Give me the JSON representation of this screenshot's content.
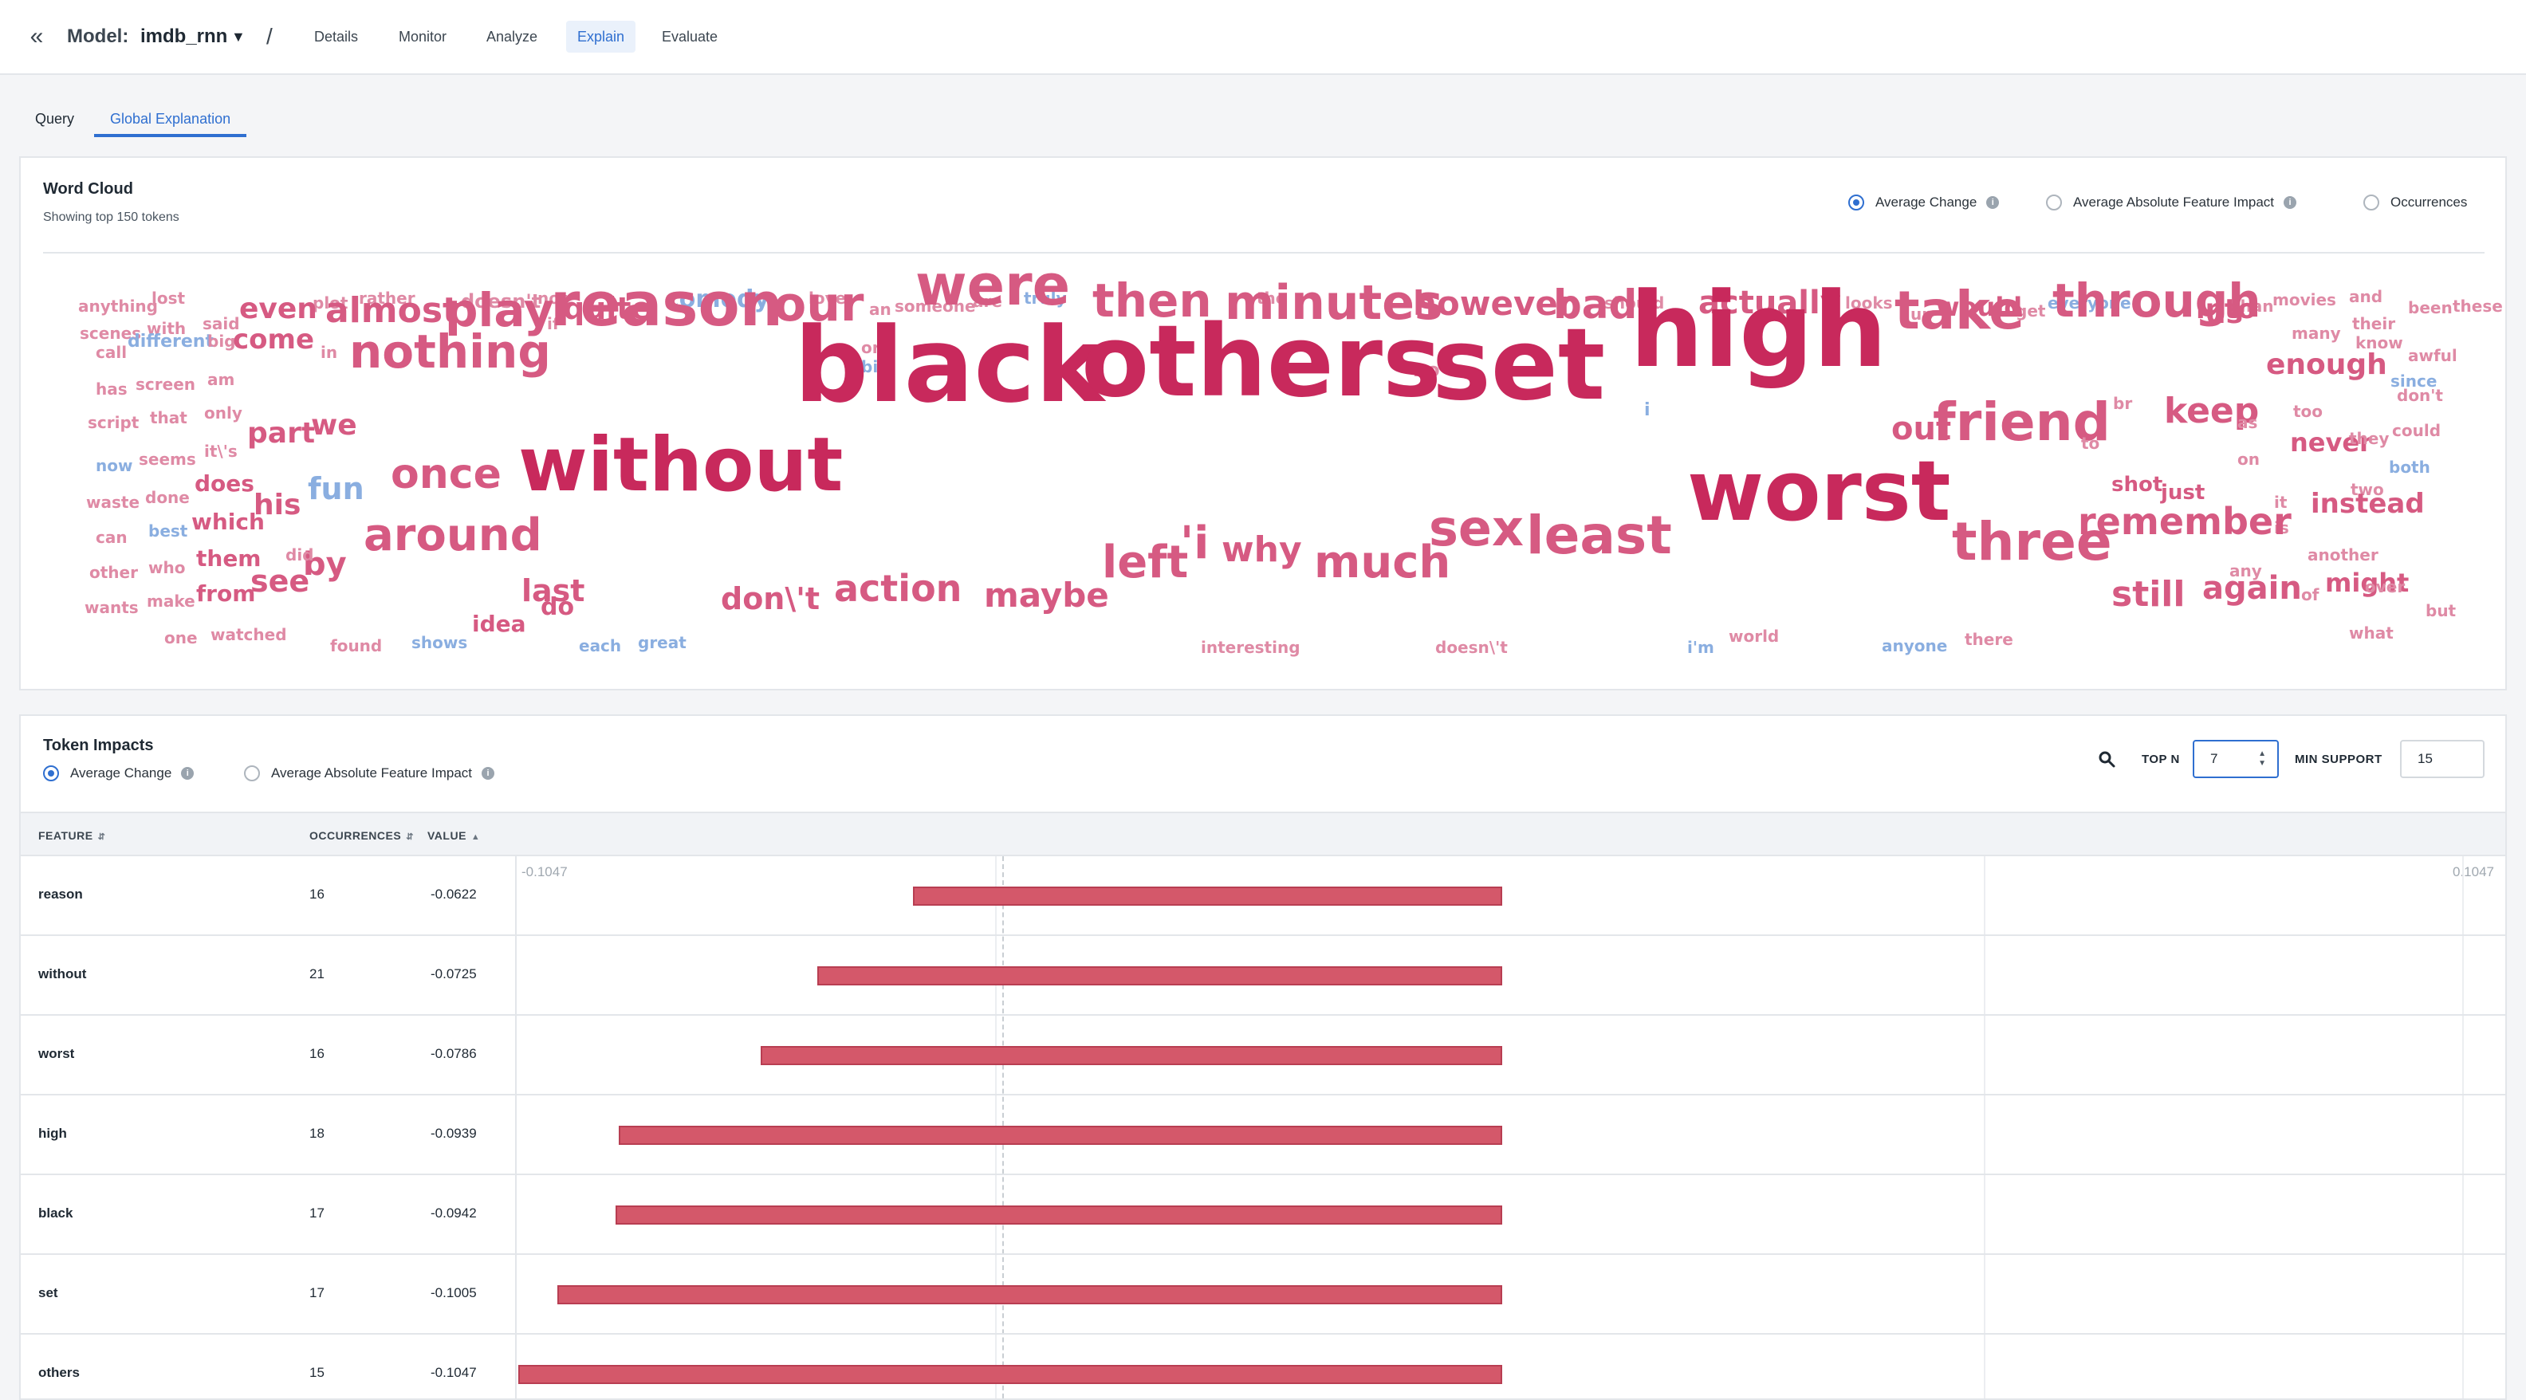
{
  "header": {
    "back_icon": "double-chevron-left-icon",
    "model_label": "Model:",
    "model_name": "imdb_rnn",
    "separator": "/",
    "nav": [
      "Details",
      "Monitor",
      "Analyze",
      "Explain",
      "Evaluate"
    ],
    "active_nav": "Explain"
  },
  "subtabs": {
    "items": [
      "Query",
      "Global Explanation"
    ],
    "active": "Global Explanation"
  },
  "word_cloud": {
    "title": "Word Cloud",
    "subtitle": "Showing top 150 tokens",
    "options": [
      "Average Change",
      "Average Absolute Feature Impact",
      "Occurrences"
    ],
    "selected": "Average Change",
    "colors": {
      "strong": "#c8295c",
      "mid": "#d65a82",
      "light": "#df8aa5",
      "blue": "#8aaee0"
    },
    "words": [
      {
        "t": "anything",
        "c": "light",
        "s": 20
      },
      {
        "t": "lost",
        "c": "light",
        "s": 20
      },
      {
        "t": "plot",
        "c": "light",
        "s": 20
      },
      {
        "t": "rather",
        "c": "light",
        "s": 20
      },
      {
        "t": "doesn't",
        "c": "light",
        "s": 24
      },
      {
        "t": "not",
        "c": "light",
        "s": 20
      },
      {
        "t": "comedy",
        "c": "blue",
        "s": 30
      },
      {
        "t": "love",
        "c": "light",
        "s": 20
      },
      {
        "t": "an",
        "c": "light",
        "s": 20
      },
      {
        "t": "someone",
        "c": "light",
        "s": 20
      },
      {
        "t": "are",
        "c": "light",
        "s": 20
      },
      {
        "t": "truly",
        "c": "blue",
        "s": 20
      },
      {
        "t": "the",
        "c": "light",
        "s": 20
      },
      {
        "t": "should",
        "c": "light",
        "s": 20
      },
      {
        "t": "looks",
        "c": "light",
        "s": 20
      },
      {
        "t": "than",
        "c": "light",
        "s": 20
      },
      {
        "t": "movies",
        "c": "light",
        "s": 20
      },
      {
        "t": "and",
        "c": "light",
        "s": 20
      },
      {
        "t": "been",
        "c": "light",
        "s": 20
      },
      {
        "t": "these",
        "c": "light",
        "s": 20
      },
      {
        "t": "scenes",
        "c": "light",
        "s": 20
      },
      {
        "t": "with",
        "c": "light",
        "s": 20
      },
      {
        "t": "said",
        "c": "light",
        "s": 20
      },
      {
        "t": "even",
        "c": "mid",
        "s": 36
      },
      {
        "t": "almost",
        "c": "mid",
        "s": 44
      },
      {
        "t": "if",
        "c": "light",
        "s": 20
      },
      {
        "t": "quite",
        "c": "mid",
        "s": 38
      },
      {
        "t": "actually",
        "c": "mid",
        "s": 40
      },
      {
        "t": "would",
        "c": "mid",
        "s": 32
      },
      {
        "t": "get",
        "c": "light",
        "s": 20
      },
      {
        "t": "everyone",
        "c": "blue",
        "s": 20
      },
      {
        "t": "up",
        "c": "light",
        "s": 20
      },
      {
        "t": "their",
        "c": "light",
        "s": 20
      },
      {
        "t": "into",
        "c": "mid",
        "s": 34
      },
      {
        "t": "call",
        "c": "light",
        "s": 20
      },
      {
        "t": "different",
        "c": "blue",
        "s": 22
      },
      {
        "t": "big",
        "c": "light",
        "s": 20
      },
      {
        "t": "come",
        "c": "mid",
        "s": 34
      },
      {
        "t": "in",
        "c": "light",
        "s": 20
      },
      {
        "t": "play",
        "c": "mid",
        "s": 58
      },
      {
        "t": "reason",
        "c": "mid",
        "s": 76
      },
      {
        "t": "our",
        "c": "mid",
        "s": 60
      },
      {
        "t": "were",
        "c": "mid",
        "s": 70
      },
      {
        "t": "then",
        "c": "mid",
        "s": 58
      },
      {
        "t": "minutes",
        "c": "mid",
        "s": 60
      },
      {
        "t": "however",
        "c": "mid",
        "s": 42
      },
      {
        "t": "no",
        "c": "light",
        "s": 24
      },
      {
        "t": "bad",
        "c": "mid",
        "s": 50
      },
      {
        "t": "or",
        "c": "light",
        "s": 20
      },
      {
        "t": "bit",
        "c": "blue",
        "s": 20
      },
      {
        "t": "take",
        "c": "mid",
        "s": 66
      },
      {
        "t": "through",
        "c": "mid",
        "s": 58
      },
      {
        "t": "us",
        "c": "mid",
        "s": 36
      },
      {
        "t": "many",
        "c": "light",
        "s": 20
      },
      {
        "t": "know",
        "c": "light",
        "s": 20
      },
      {
        "t": "awful",
        "c": "light",
        "s": 20
      },
      {
        "t": "since",
        "c": "blue",
        "s": 20
      },
      {
        "t": "has",
        "c": "light",
        "s": 20
      },
      {
        "t": "screen",
        "c": "light",
        "s": 20
      },
      {
        "t": "am",
        "c": "light",
        "s": 20
      },
      {
        "t": "script",
        "c": "light",
        "s": 20
      },
      {
        "t": "that",
        "c": "light",
        "s": 20
      },
      {
        "t": "only",
        "c": "light",
        "s": 20
      },
      {
        "t": "nothing",
        "c": "mid",
        "s": 58
      },
      {
        "t": "enough",
        "c": "mid",
        "s": 36
      },
      {
        "t": "don't",
        "c": "light",
        "s": 20
      },
      {
        "t": "black",
        "c": "strong",
        "s": 130
      },
      {
        "t": "others",
        "c": "strong",
        "s": 124
      },
      {
        "t": "set",
        "c": "strong",
        "s": 124
      },
      {
        "t": "high",
        "c": "strong",
        "s": 130
      },
      {
        "t": "i",
        "c": "blue",
        "s": 22
      },
      {
        "t": "br",
        "c": "light",
        "s": 20
      },
      {
        "t": "too",
        "c": "light",
        "s": 20
      },
      {
        "t": "could",
        "c": "light",
        "s": 20
      },
      {
        "t": "part",
        "c": "mid",
        "s": 36
      },
      {
        "t": "we",
        "c": "mid",
        "s": 36
      },
      {
        "t": "it\\'s",
        "c": "light",
        "s": 20
      },
      {
        "t": "now",
        "c": "blue",
        "s": 20
      },
      {
        "t": "seems",
        "c": "light",
        "s": 20
      },
      {
        "t": "out",
        "c": "mid",
        "s": 40
      },
      {
        "t": "friend",
        "c": "mid",
        "s": 66
      },
      {
        "t": "keep",
        "c": "mid",
        "s": 44
      },
      {
        "t": "as",
        "c": "light",
        "s": 20
      },
      {
        "t": "to",
        "c": "light",
        "s": 20
      },
      {
        "t": "never",
        "c": "mid",
        "s": 32
      },
      {
        "t": "they",
        "c": "light",
        "s": 20
      },
      {
        "t": "both",
        "c": "blue",
        "s": 20
      },
      {
        "t": "on",
        "c": "light",
        "s": 20
      },
      {
        "t": "waste",
        "c": "light",
        "s": 20
      },
      {
        "t": "done",
        "c": "light",
        "s": 20
      },
      {
        "t": "does",
        "c": "mid",
        "s": 28
      },
      {
        "t": "his",
        "c": "mid",
        "s": 36
      },
      {
        "t": "fun",
        "c": "blue",
        "s": 38
      },
      {
        "t": "once",
        "c": "mid",
        "s": 52
      },
      {
        "t": "without",
        "c": "strong",
        "s": 94
      },
      {
        "t": "shot",
        "c": "mid",
        "s": 26
      },
      {
        "t": "just",
        "c": "mid",
        "s": 26
      },
      {
        "t": "it",
        "c": "light",
        "s": 20
      },
      {
        "t": "two",
        "c": "light",
        "s": 20
      },
      {
        "t": "can",
        "c": "light",
        "s": 20
      },
      {
        "t": "best",
        "c": "blue",
        "s": 20
      },
      {
        "t": "which",
        "c": "mid",
        "s": 28
      },
      {
        "t": "instead",
        "c": "mid",
        "s": 34
      },
      {
        "t": "is",
        "c": "light",
        "s": 20
      },
      {
        "t": "around",
        "c": "mid",
        "s": 56
      },
      {
        "t": "worst",
        "c": "strong",
        "s": 104
      },
      {
        "t": "remember",
        "c": "mid",
        "s": 46
      },
      {
        "t": "other",
        "c": "light",
        "s": 20
      },
      {
        "t": "who",
        "c": "light",
        "s": 20
      },
      {
        "t": "them",
        "c": "mid",
        "s": 28
      },
      {
        "t": "by",
        "c": "mid",
        "s": 40
      },
      {
        "t": "did",
        "c": "light",
        "s": 20
      },
      {
        "t": "left",
        "c": "mid",
        "s": 56
      },
      {
        "t": "'i",
        "c": "mid",
        "s": 56
      },
      {
        "t": "why",
        "c": "mid",
        "s": 44
      },
      {
        "t": "much",
        "c": "mid",
        "s": 56
      },
      {
        "t": "sex",
        "c": "mid",
        "s": 62
      },
      {
        "t": "least",
        "c": "mid",
        "s": 66
      },
      {
        "t": "three",
        "c": "mid",
        "s": 66
      },
      {
        "t": "any",
        "c": "light",
        "s": 20
      },
      {
        "t": "another",
        "c": "light",
        "s": 20
      },
      {
        "t": "wants",
        "c": "light",
        "s": 20
      },
      {
        "t": "make",
        "c": "light",
        "s": 20
      },
      {
        "t": "from",
        "c": "mid",
        "s": 28
      },
      {
        "t": "see",
        "c": "mid",
        "s": 38
      },
      {
        "t": "last",
        "c": "mid",
        "s": 38
      },
      {
        "t": "do",
        "c": "mid",
        "s": 30
      },
      {
        "t": "don\\'t",
        "c": "mid",
        "s": 38
      },
      {
        "t": "action",
        "c": "mid",
        "s": 46
      },
      {
        "t": "maybe",
        "c": "mid",
        "s": 42
      },
      {
        "t": "still",
        "c": "mid",
        "s": 44
      },
      {
        "t": "again",
        "c": "mid",
        "s": 40
      },
      {
        "t": "of",
        "c": "light",
        "s": 20
      },
      {
        "t": "might",
        "c": "mid",
        "s": 32
      },
      {
        "t": "over",
        "c": "light",
        "s": 20
      },
      {
        "t": "but",
        "c": "light",
        "s": 20
      },
      {
        "t": "one",
        "c": "light",
        "s": 20
      },
      {
        "t": "watched",
        "c": "light",
        "s": 20
      },
      {
        "t": "found",
        "c": "light",
        "s": 20
      },
      {
        "t": "shows",
        "c": "blue",
        "s": 20
      },
      {
        "t": "idea",
        "c": "mid",
        "s": 28
      },
      {
        "t": "each",
        "c": "blue",
        "s": 20
      },
      {
        "t": "great",
        "c": "blue",
        "s": 20
      },
      {
        "t": "interesting",
        "c": "light",
        "s": 20
      },
      {
        "t": "doesn\\'t",
        "c": "light",
        "s": 20
      },
      {
        "t": "i'm",
        "c": "blue",
        "s": 20
      },
      {
        "t": "world",
        "c": "light",
        "s": 20
      },
      {
        "t": "anyone",
        "c": "blue",
        "s": 20
      },
      {
        "t": "there",
        "c": "light",
        "s": 20
      },
      {
        "t": "what",
        "c": "light",
        "s": 20
      }
    ]
  },
  "token_impacts": {
    "title": "Token Impacts",
    "options": [
      "Average Change",
      "Average Absolute Feature Impact"
    ],
    "selected": "Average Change",
    "search_icon": "search-icon",
    "top_n_label": "TOP N",
    "top_n_value": "7",
    "min_support_label": "MIN SUPPORT",
    "min_support_value": "15",
    "columns": {
      "feature": "FEATURE",
      "occurrences": "OCCURRENCES",
      "value": "VALUE"
    },
    "axis": {
      "min_label": "-0.1047",
      "max_label": "0.1047",
      "min": -0.1047,
      "max": 0.1047
    },
    "rows": [
      {
        "feature": "reason",
        "occurrences": "16",
        "value": "-0.0622",
        "v": -0.0622
      },
      {
        "feature": "without",
        "occurrences": "21",
        "value": "-0.0725",
        "v": -0.0725
      },
      {
        "feature": "worst",
        "occurrences": "16",
        "value": "-0.0786",
        "v": -0.0786
      },
      {
        "feature": "high",
        "occurrences": "18",
        "value": "-0.0939",
        "v": -0.0939
      },
      {
        "feature": "black",
        "occurrences": "17",
        "value": "-0.0942",
        "v": -0.0942
      },
      {
        "feature": "set",
        "occurrences": "17",
        "value": "-0.1005",
        "v": -0.1005
      },
      {
        "feature": "others",
        "occurrences": "15",
        "value": "-0.1047",
        "v": -0.1047
      }
    ],
    "bar_color": "#d4586a"
  }
}
